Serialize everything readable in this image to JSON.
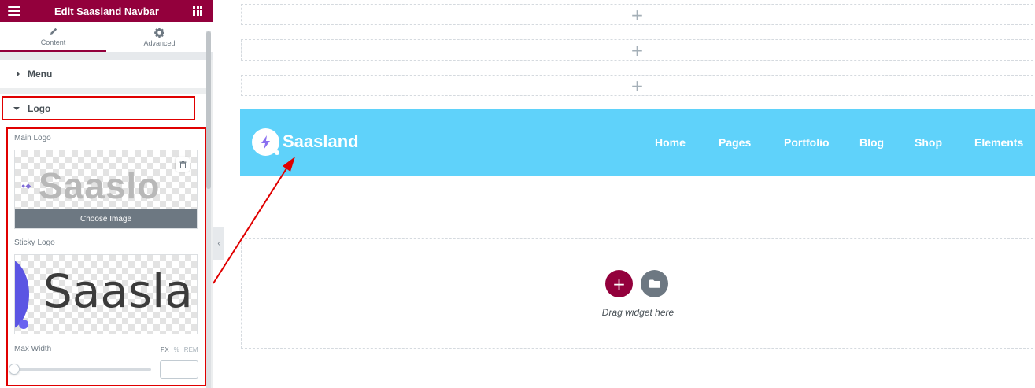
{
  "panel": {
    "title": "Edit Saasland Navbar",
    "tabs": [
      {
        "label": "Content",
        "icon": "pencil-icon"
      },
      {
        "label": "Advanced",
        "icon": "gear-icon"
      }
    ],
    "sections": {
      "menu": "Menu",
      "logo": "Logo"
    },
    "main_logo": {
      "label": "Main Logo",
      "preview_text": "Saaslo",
      "choose_label": "Choose Image"
    },
    "sticky_logo": {
      "label": "Sticky Logo",
      "preview_text": "Saasla"
    },
    "max_width": {
      "label": "Max Width",
      "units": [
        "PX",
        "%",
        "REM"
      ],
      "active_unit": "PX",
      "value": ""
    },
    "accent_color": "#93003c"
  },
  "canvas": {
    "add_section_rows": 3,
    "navbar": {
      "brand": "Saasland",
      "background": "#5fd2fa",
      "menu": [
        "Home",
        "Pages",
        "Portfolio",
        "Blog",
        "Shop",
        "Elements"
      ]
    },
    "drop_zone": {
      "text": "Drag widget here"
    }
  },
  "annotation_color": "#e00000"
}
